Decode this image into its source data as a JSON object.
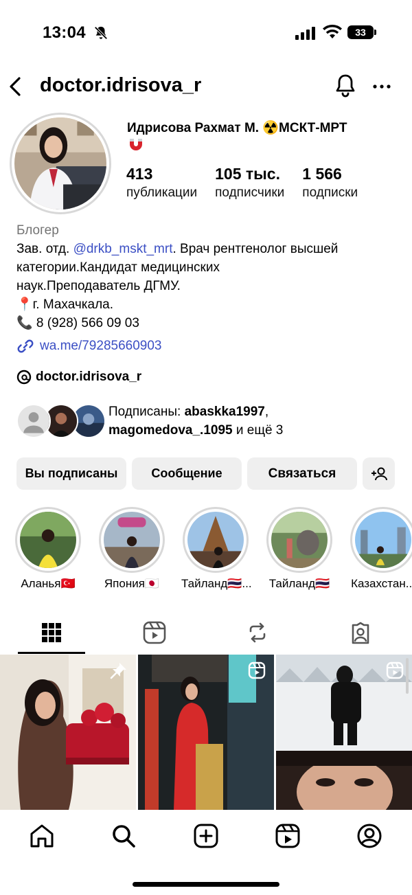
{
  "status": {
    "time": "13:04",
    "battery": "33"
  },
  "header": {
    "username": "doctor.idrisova_r"
  },
  "profile": {
    "name": "Идрисова Рахмат М.",
    "name_emoji": "☢️",
    "name_suffix": "МСКТ-МРТ",
    "stats": [
      {
        "value": "413",
        "label": "публикации"
      },
      {
        "value": "105 тыс.",
        "label": "подписчики"
      },
      {
        "value": "1 566",
        "label": "подписки"
      }
    ]
  },
  "bio": {
    "category": "Блогер",
    "line1_prefix": "Зав. отд. ",
    "mention": "@drkb_mskt_mrt",
    "line1_suffix": ". Врач рентгенолог высшей",
    "line2": "категории.Кандидат медицинских",
    "line3": "наук.Преподаватель ДГМУ.",
    "location": "📍г. Махачкала.",
    "phone": "📞 8 (928) 566 09 03",
    "link": "wa.me/79285660903",
    "threads": "doctor.idrisova_r"
  },
  "followed_by": {
    "prefix": "Подписаны: ",
    "user1": "abaskka1997",
    "sep": ",",
    "user2": "magomedova_.1095",
    "suffix": " и ещё 3"
  },
  "buttons": {
    "following": "Вы подписаны",
    "message": "Сообщение",
    "contact": "Связаться"
  },
  "highlights": [
    {
      "label": "Аланья🇹🇷"
    },
    {
      "label": "Япония🇯🇵"
    },
    {
      "label": "Тайланд🇹🇭..."
    },
    {
      "label": "Тайланд🇹🇭"
    },
    {
      "label": "Казахстан..."
    }
  ],
  "colors": {
    "link": "#3b4fc4",
    "button_bg": "#efefef",
    "muted": "#737373"
  }
}
